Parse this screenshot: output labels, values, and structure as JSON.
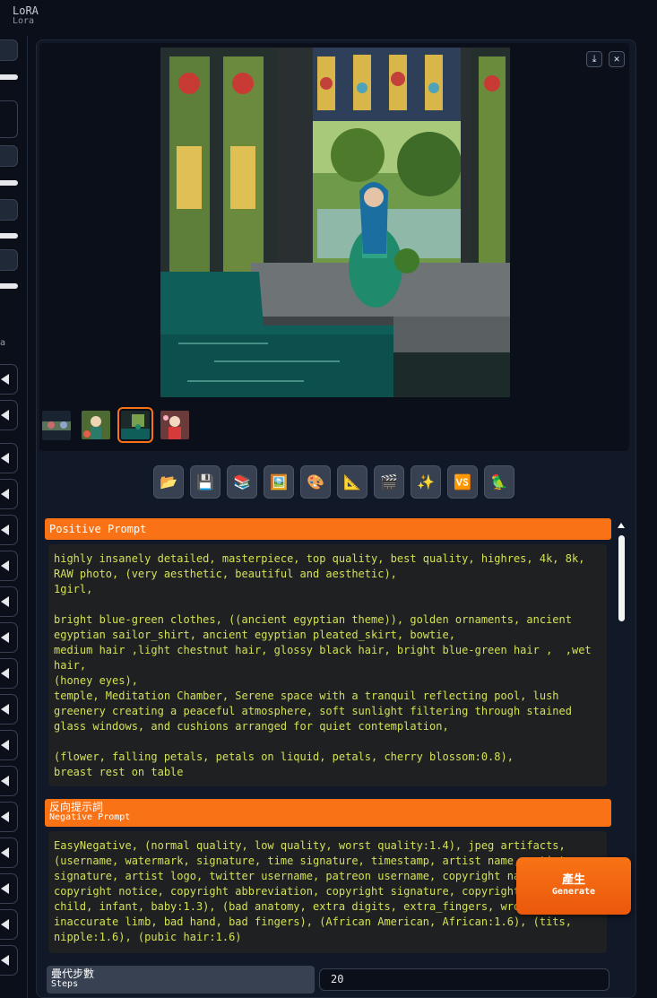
{
  "header": {
    "title": "LoRA",
    "subtitle": "Lora"
  },
  "left_column": {
    "partial_text": "a"
  },
  "image_actions": {
    "download_icon": "⤓",
    "close_icon": "✕"
  },
  "toolbar": {
    "buttons": [
      {
        "icon": "folder-icon",
        "glyph": "📂"
      },
      {
        "icon": "save-icon",
        "glyph": "💾"
      },
      {
        "icon": "zip-icon",
        "glyph": "📚"
      },
      {
        "icon": "image-icon",
        "glyph": "🖼️"
      },
      {
        "icon": "palette-icon",
        "glyph": "🎨"
      },
      {
        "icon": "triangle-ruler-icon",
        "glyph": "📐"
      },
      {
        "icon": "clapper-icon",
        "glyph": "🎬"
      },
      {
        "icon": "sparkles-icon",
        "glyph": "✨"
      },
      {
        "icon": "vs-icon",
        "glyph": "🆚"
      },
      {
        "icon": "parrot-icon",
        "glyph": "🦜"
      }
    ]
  },
  "positive_prompt": {
    "label": "Positive Prompt",
    "text": "highly insanely detailed, masterpiece, top quality, best quality, highres, 4k, 8k,\nRAW photo, (very aesthetic, beautiful and aesthetic),\n1girl,\n\nbright blue-green clothes, ((ancient egyptian theme)), golden ornaments, ancient\negyptian sailor_shirt, ancient egyptian pleated_skirt, bowtie,\nmedium hair ,light chestnut hair, glossy black hair, bright blue-green hair ,  ,wet\nhair,\n(honey eyes),\ntemple, Meditation Chamber, Serene space with a tranquil reflecting pool, lush\ngreenery creating a peaceful atmosphere, soft sunlight filtering through stained\nglass windows, and cushions arranged for quiet contemplation,\n\n(flower, falling petals, petals on liquid, petals, cherry blossom:0.8),\nbreast rest on table"
  },
  "negative_prompt": {
    "label_cn": "反向提示詞",
    "label_en": "Negative Prompt",
    "text": "EasyNegative, (normal quality, low quality, worst quality:1.4), jpeg artifacts,\n(username, watermark, signature, time signature, timestamp, artist name, artist\nsignature, artist logo, twitter username, patreon username, copyright name,\ncopyright notice, copyright abbreviation, copyright signature, copyright\nchild, infant, baby:1.3), (bad anatomy, extra digits, extra_fingers, wrong\ninaccurate limb, bad hand, bad fingers), (African American, African:1.6), (tits,\nnipple:1.6), (pubic hair:1.6)"
  },
  "generate": {
    "label_cn": "產生",
    "label_en": "Generate"
  },
  "steps": {
    "label_cn": "疊代步數",
    "label_en": "Steps",
    "value": "20"
  },
  "colors": {
    "accent": "#f97316",
    "background": "#0b0f19",
    "prompt_text": "#d4e157"
  }
}
